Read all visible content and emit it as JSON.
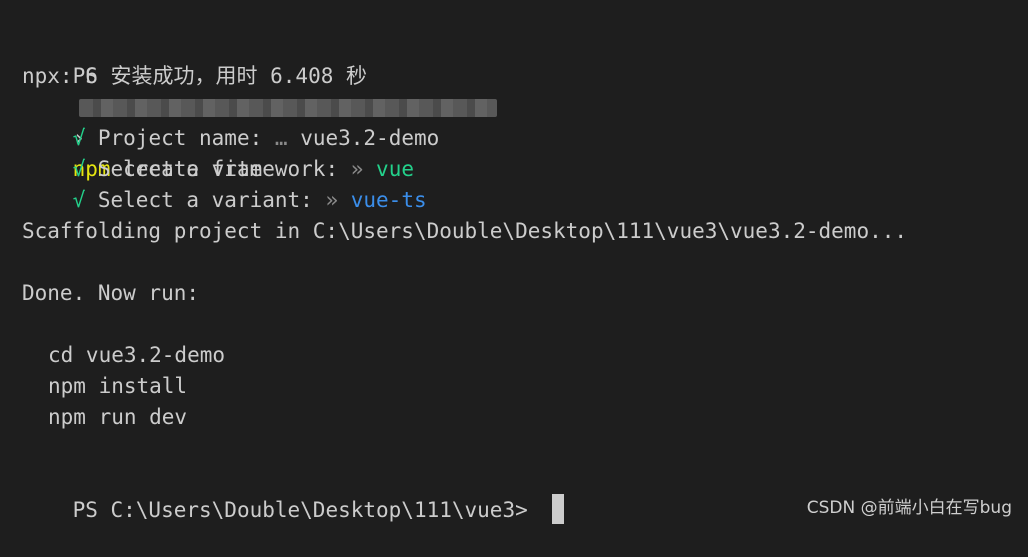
{
  "terminal": {
    "prompt1": {
      "ps": "PS",
      "arrow": "›",
      "cmd": "npm",
      "args": " create vite"
    },
    "npx_line": "npx: 6 安装成功，用时 6.408 秒",
    "checks": [
      {
        "mark": "√",
        "label": " Project name: ",
        "sep": "…",
        "value": " vue3.2-demo"
      },
      {
        "mark": "√",
        "label": " Select a framework: ",
        "sep": "»",
        "value": " vue"
      },
      {
        "mark": "√",
        "label": " Select a variant: ",
        "sep": "»",
        "value": " vue-ts"
      }
    ],
    "scaffolding": "Scaffolding project in C:\\Users\\Double\\Desktop\\111\\vue3\\vue3.2-demo...",
    "done": "Done. Now run:",
    "commands": [
      "cd vue3.2-demo",
      "npm install",
      "npm run dev"
    ],
    "final_prompt": "PS C:\\Users\\Double\\Desktop\\111\\vue3> "
  },
  "watermark": "CSDN @前端小白在写bug",
  "colors": {
    "background": "#1e1e1e",
    "text": "#cccccc",
    "command": "#e5e510",
    "success": "#23d18b",
    "variant": "#3b8eea"
  }
}
